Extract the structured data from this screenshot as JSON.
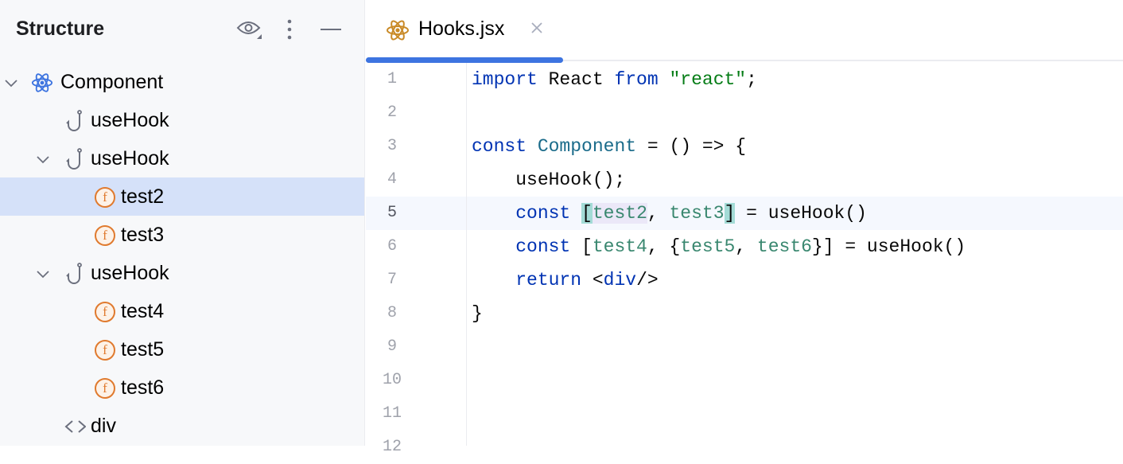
{
  "panel": {
    "title": "Structure"
  },
  "tree": [
    {
      "label": "Component",
      "icon": "react-icon",
      "level": 0,
      "chevron": true
    },
    {
      "label": "useHook",
      "icon": "hook-icon",
      "level": 1,
      "chevron": false
    },
    {
      "label": "useHook",
      "icon": "hook-icon",
      "level": 1,
      "chevron": true
    },
    {
      "label": "test2",
      "icon": "function-icon",
      "level": 2,
      "chevron": false,
      "selected": true
    },
    {
      "label": "test3",
      "icon": "function-icon",
      "level": 2,
      "chevron": false
    },
    {
      "label": "useHook",
      "icon": "hook-icon",
      "level": 1,
      "chevron": true
    },
    {
      "label": "test4",
      "icon": "function-icon",
      "level": 2,
      "chevron": false
    },
    {
      "label": "test5",
      "icon": "function-icon",
      "level": 2,
      "chevron": false
    },
    {
      "label": "test6",
      "icon": "function-icon",
      "level": 2,
      "chevron": false
    },
    {
      "label": "div",
      "icon": "tag-icon",
      "level": 1,
      "chevron": false
    }
  ],
  "tab": {
    "name": "Hooks.jsx"
  },
  "editor": {
    "current_line": 5,
    "lines": [
      {
        "n": "1",
        "tokens": [
          {
            "t": "import",
            "c": "kw"
          },
          {
            "t": " React ",
            "c": "pl"
          },
          {
            "t": "from",
            "c": "kw"
          },
          {
            "t": " ",
            "c": "pl"
          },
          {
            "t": "\"react\"",
            "c": "str"
          },
          {
            "t": ";",
            "c": "pl"
          }
        ]
      },
      {
        "n": "2",
        "tokens": []
      },
      {
        "n": "3",
        "tokens": [
          {
            "t": "const",
            "c": "kw"
          },
          {
            "t": " ",
            "c": "pl"
          },
          {
            "t": "Component",
            "c": "cls"
          },
          {
            "t": " = () => {",
            "c": "pl"
          }
        ]
      },
      {
        "n": "4",
        "tokens": [
          {
            "t": "    useHook();",
            "c": "pl"
          }
        ]
      },
      {
        "n": "5",
        "tokens": [
          {
            "t": "    ",
            "c": "pl"
          },
          {
            "t": "const",
            "c": "kw"
          },
          {
            "t": " ",
            "c": "pl"
          },
          {
            "t": "[",
            "c": "pl br"
          },
          {
            "t": "test2",
            "c": "var hl"
          },
          {
            "t": ", ",
            "c": "pl"
          },
          {
            "t": "test3",
            "c": "var"
          },
          {
            "t": "]",
            "c": "pl br"
          },
          {
            "t": " = useHook()",
            "c": "pl"
          }
        ]
      },
      {
        "n": "6",
        "tokens": [
          {
            "t": "    ",
            "c": "pl"
          },
          {
            "t": "const",
            "c": "kw"
          },
          {
            "t": " [",
            "c": "pl"
          },
          {
            "t": "test4",
            "c": "var"
          },
          {
            "t": ", {",
            "c": "pl"
          },
          {
            "t": "test5",
            "c": "var"
          },
          {
            "t": ", ",
            "c": "pl"
          },
          {
            "t": "test6",
            "c": "var"
          },
          {
            "t": "}] = useHook()",
            "c": "pl"
          }
        ]
      },
      {
        "n": "7",
        "tokens": [
          {
            "t": "    ",
            "c": "pl"
          },
          {
            "t": "return",
            "c": "kw"
          },
          {
            "t": " <",
            "c": "pl"
          },
          {
            "t": "div",
            "c": "tag"
          },
          {
            "t": "/>",
            "c": "pl"
          }
        ]
      },
      {
        "n": "8",
        "tokens": [
          {
            "t": "}",
            "c": "pl"
          }
        ]
      },
      {
        "n": "9",
        "tokens": []
      },
      {
        "n": "10",
        "tokens": []
      },
      {
        "n": "11",
        "tokens": []
      },
      {
        "n": "12",
        "tokens": []
      }
    ]
  }
}
